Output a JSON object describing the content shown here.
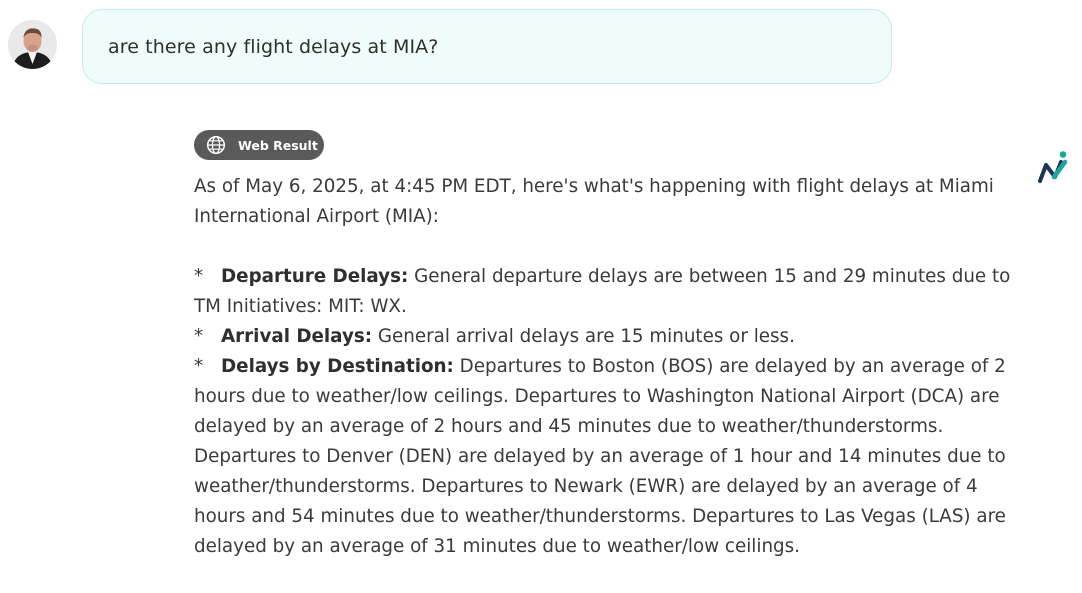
{
  "user_message": {
    "text": "are there any flight delays at MIA?"
  },
  "response": {
    "badge_label": "Web Result",
    "intro": "As of May 6, 2025, at 4:45 PM EDT, here's what's happening with flight delays at Miami International Airport (MIA):",
    "bullets": [
      {
        "marker": "*",
        "title": "Departure Delays:",
        "text": " General departure delays are between 15 and 29 minutes due to TM Initiatives: MIT: WX."
      },
      {
        "marker": "*",
        "title": "Arrival Delays:",
        "text": " General arrival delays are 15 minutes or less."
      },
      {
        "marker": "*",
        "title": "Delays by Destination:",
        "text": " Departures to Boston (BOS) are delayed by an average of 2 hours due to weather/low ceilings. Departures to Washington National Airport (DCA) are delayed by an average of 2 hours and 45 minutes due to weather/thunderstorms. Departures to Denver (DEN) are delayed by an average of 1 hour and 14 minutes due to weather/thunderstorms. Departures to Newark (EWR) are delayed by an average of 4 hours and 54 minutes due to weather/thunderstorms. Departures to Las Vegas (LAS) are delayed by an average of 31 minutes due to weather/low ceilings."
      }
    ]
  },
  "icons": {
    "avatar": "user-avatar",
    "badge": "globe-icon",
    "brand": "brand-logo-icon"
  },
  "colors": {
    "user_bubble_bg": "#effcfa",
    "user_bubble_border": "#bfeee6",
    "badge_bg": "#5a5a5a",
    "logo_teal": "#1aa79a",
    "logo_navy": "#1e3552"
  }
}
